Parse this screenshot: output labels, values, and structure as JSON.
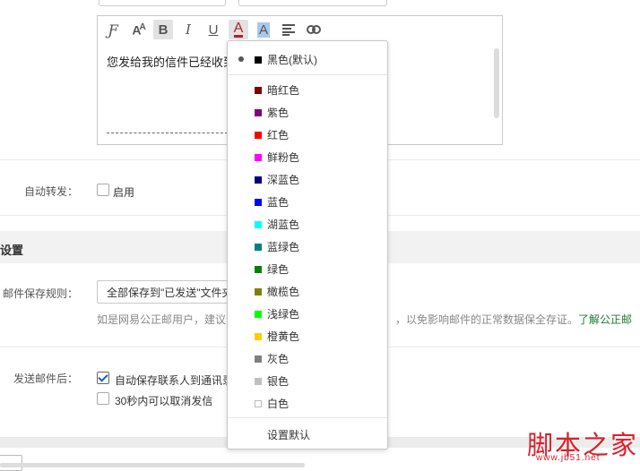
{
  "editor": {
    "toolbar": [
      {
        "icon": "font-family-icon",
        "glyph": "Ƒ"
      },
      {
        "icon": "font-size-icon",
        "glyph": "AA"
      },
      {
        "icon": "bold-icon",
        "glyph": "B"
      },
      {
        "icon": "italic-icon",
        "glyph": "I"
      },
      {
        "icon": "underline-icon",
        "glyph": "U"
      },
      {
        "icon": "font-color-icon",
        "glyph": "A"
      },
      {
        "icon": "background-color-icon",
        "glyph": "A"
      },
      {
        "icon": "align-icon",
        "glyph": "≡"
      },
      {
        "icon": "link-icon",
        "glyph": "⊂⊃"
      }
    ],
    "content_text": "您发给我的信件已经收到",
    "signature_separator": "--------------------------------"
  },
  "auto_forward": {
    "label": "自动转发：",
    "checkbox_label": "启用",
    "checked": false
  },
  "section": {
    "title": "设置"
  },
  "save_rule": {
    "label": "邮件保存规则：",
    "select_value": "全部保存到\"已发送\"文件夹",
    "note_prefix": "如是网易公正邮用户，建议",
    "note_suffix": "，以免影响邮件的正常数据保全存证。",
    "note_link": "了解公正邮"
  },
  "after_send": {
    "label": "发送邮件后：",
    "option1": "自动保存联系人到通讯录",
    "option1_checked": true,
    "option2": "30秒内可以取消发信",
    "option2_checked": false
  },
  "color_menu": {
    "default_item": {
      "label": "黑色(默认)",
      "color": "#000000",
      "selected": true
    },
    "items": [
      {
        "label": "暗红色",
        "color": "#800000"
      },
      {
        "label": "紫色",
        "color": "#800080"
      },
      {
        "label": "红色",
        "color": "#ff0000"
      },
      {
        "label": "鲜粉色",
        "color": "#ff00ff"
      },
      {
        "label": "深蓝色",
        "color": "#000080"
      },
      {
        "label": "蓝色",
        "color": "#0000ff"
      },
      {
        "label": "湖蓝色",
        "color": "#00ffff"
      },
      {
        "label": "蓝绿色",
        "color": "#008080"
      },
      {
        "label": "绿色",
        "color": "#008000"
      },
      {
        "label": "橄榄色",
        "color": "#808000"
      },
      {
        "label": "浅绿色",
        "color": "#00ff00"
      },
      {
        "label": "橙黄色",
        "color": "#ffcc00"
      },
      {
        "label": "灰色",
        "color": "#808080"
      },
      {
        "label": "银色",
        "color": "#c0c0c0"
      },
      {
        "label": "白色",
        "color": "#ffffff"
      }
    ],
    "set_default_label": "设置默认"
  },
  "watermark": {
    "text": "脚本之家",
    "url": "www.jb51.net"
  }
}
